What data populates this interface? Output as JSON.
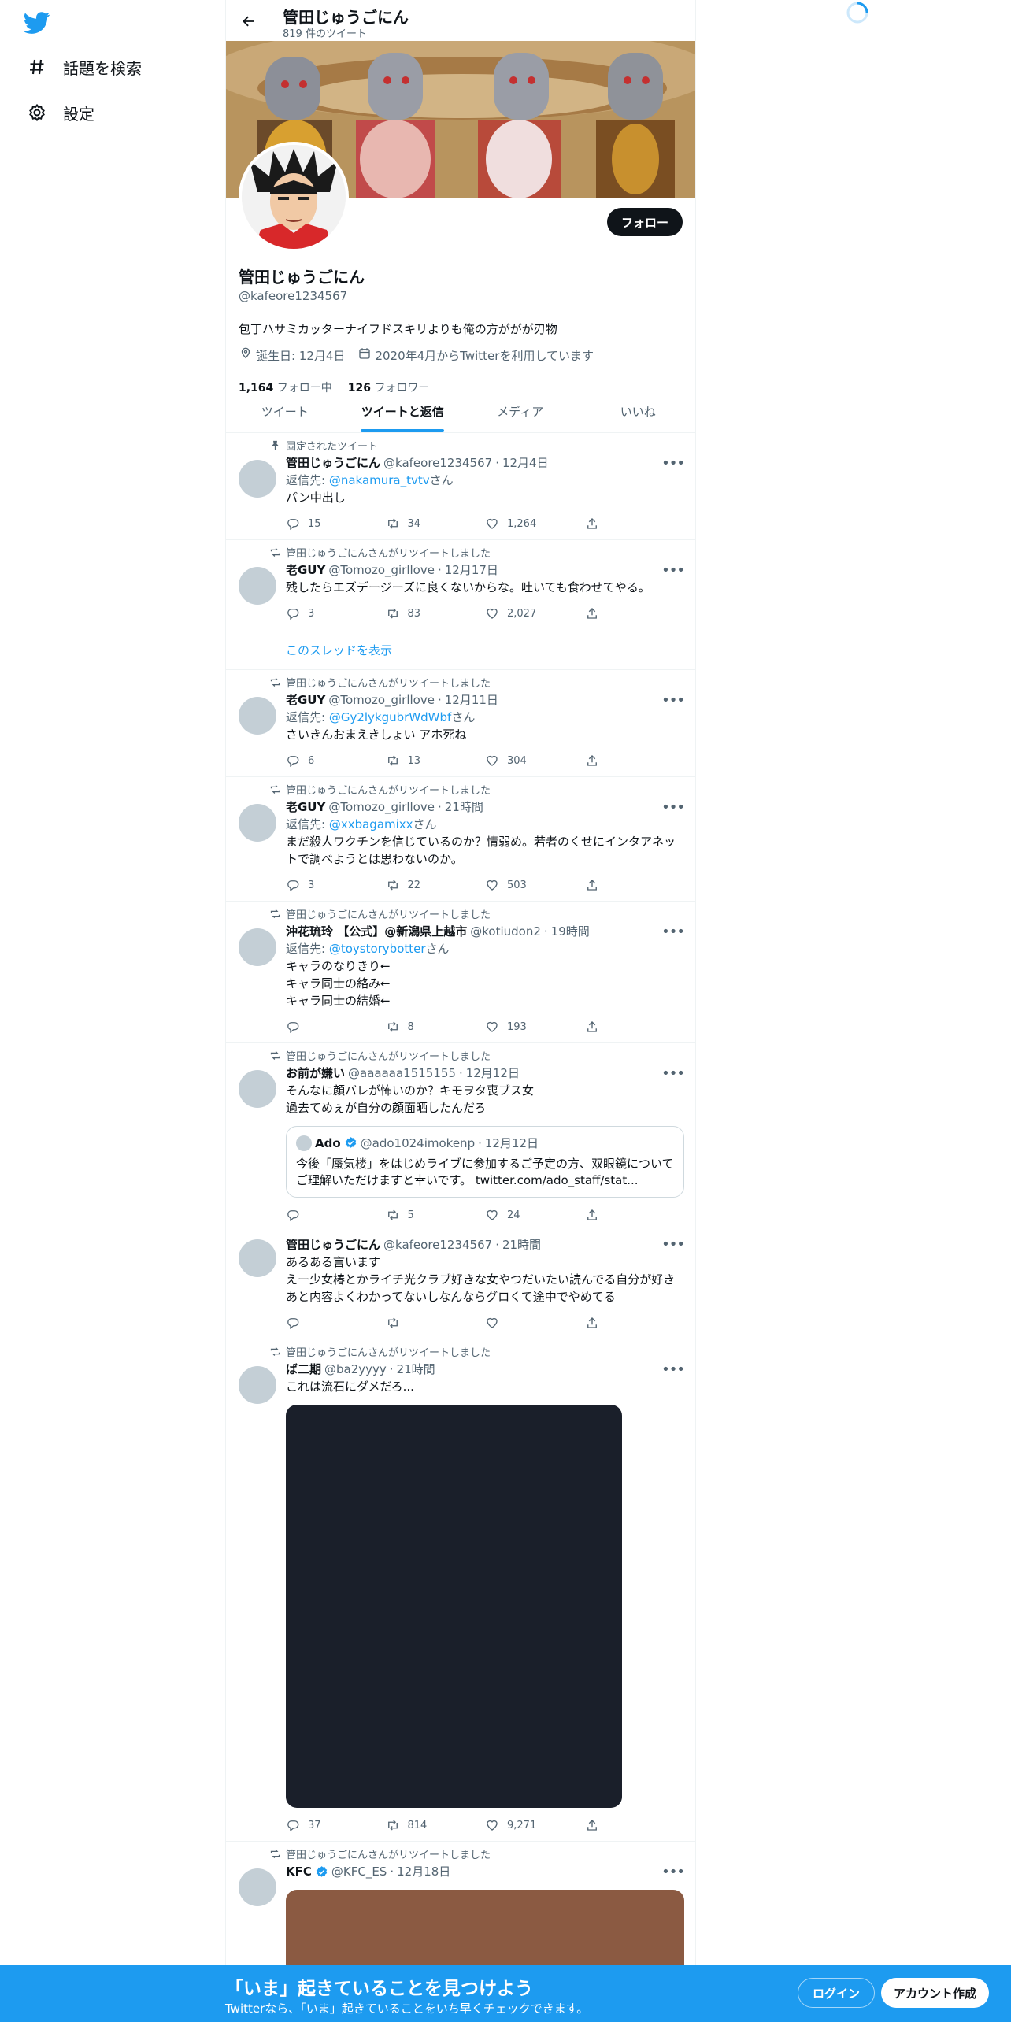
{
  "nav": {
    "logo": "twitter-bird-icon",
    "items": [
      {
        "label": "話題を検索",
        "icon": "hashtag-icon"
      },
      {
        "label": "設定",
        "icon": "gear-icon"
      }
    ]
  },
  "header": {
    "name": "管田じゅうごにん",
    "tweet_count": "819 件のツイート"
  },
  "profile": {
    "name": "管田じゅうごにん",
    "handle": "@kafeore1234567",
    "bio": "包丁ハサミカッターナイフドスキリよりも俺の方ががが刃物",
    "birthday": "誕生日: 12月4日",
    "joined": "2020年4月からTwitterを利用しています",
    "following_count": "1,164",
    "following_label": "フォロー中",
    "followers_count": "126",
    "followers_label": "フォロワー",
    "follow_button": "フォロー"
  },
  "tabs": [
    {
      "label": "ツイート",
      "active": false
    },
    {
      "label": "ツイートと返信",
      "active": true
    },
    {
      "label": "メディア",
      "active": false
    },
    {
      "label": "いいね",
      "active": false
    }
  ],
  "tweets": [
    {
      "social": "固定されたツイート",
      "social_icon": "pin-icon",
      "name": "管田じゅうごにん",
      "handle": "@kafeore1234567",
      "time": "12月4日",
      "reply_prefix": "返信先: ",
      "reply_to": "@nakamura_tvtv",
      "reply_suffix": "さん",
      "text": "パン中出し",
      "replies": "15",
      "retweets": "34",
      "likes": "1,264"
    },
    {
      "social": "管田じゅうごにんさんがリツイートしました",
      "social_icon": "retweet-icon",
      "name": "老GUY",
      "handle": "@Tomozo_girllove",
      "time": "12月17日",
      "text": "残したらエズデージーズに良くないからな。吐いても食わせてやる。",
      "replies": "3",
      "retweets": "83",
      "likes": "2,027",
      "thread": "このスレッドを表示"
    },
    {
      "social": "管田じゅうごにんさんがリツイートしました",
      "social_icon": "retweet-icon",
      "name": "老GUY",
      "handle": "@Tomozo_girllove",
      "time": "12月11日",
      "reply_prefix": "返信先: ",
      "reply_to": "@Gy2lykgubrWdWbf",
      "reply_suffix": "さん",
      "text": "さいきんおまえきしょい アホ死ね",
      "replies": "6",
      "retweets": "13",
      "likes": "304"
    },
    {
      "social": "管田じゅうごにんさんがリツイートしました",
      "social_icon": "retweet-icon",
      "name": "老GUY",
      "handle": "@Tomozo_girllove",
      "time": "21時間",
      "reply_prefix": "返信先: ",
      "reply_to": "@xxbagamixx",
      "reply_suffix": "さん",
      "text": "まだ殺人ワクチンを信じているのか？情弱め。若者のくせにインタアネットで調べようとは思わないのか。",
      "replies": "3",
      "retweets": "22",
      "likes": "503"
    },
    {
      "social": "管田じゅうごにんさんがリツイートしました",
      "social_icon": "retweet-icon",
      "name": "沖花琉玲 【公式】@新潟県上越市",
      "handle": "@kotiudon2",
      "time": "19時間",
      "reply_prefix": "返信先: ",
      "reply_to": "@toystorybotter",
      "reply_suffix": "さん",
      "text": "キャラのなりきり←\nキャラ同士の絡み←\nキャラ同士の結婚←",
      "replies": "",
      "retweets": "8",
      "likes": "193"
    },
    {
      "social": "管田じゅうごにんさんがリツイートしました",
      "social_icon": "retweet-icon",
      "name": "お前が嫌い",
      "handle": "@aaaaaa1515155",
      "time": "12月12日",
      "text": "そんなに顔バレが怖いのか？キモヲタ喪ブス女\n過去てめぇが自分の顔面晒したんだろ",
      "quote": {
        "name": "Ado",
        "handle": "@ado1024imokenp",
        "time": "12月12日",
        "text": "今後「蜃気楼」をはじめライブに参加するご予定の方、双眼鏡についてご理解いただけますと幸いです。 twitter.com/ado_staff/stat..."
      },
      "replies": "",
      "retweets": "5",
      "likes": "24"
    },
    {
      "social": "",
      "social_icon": "",
      "name": "管田じゅうごにん",
      "handle": "@kafeore1234567",
      "time": "21時間",
      "text": "あるある言います\nえー少女椿とかライチ光クラブ好きな女やつだいたい読んでる自分が好き\nあと内容よくわかってないしなんならグロくて途中でやめてる",
      "replies": "",
      "retweets": "",
      "likes": ""
    },
    {
      "social": "管田じゅうごにんさんがリツイートしました",
      "social_icon": "retweet-icon",
      "name": "ば二期",
      "handle": "@ba2yyyy",
      "time": "21時間",
      "text": "これは流石にダメだろ...",
      "media": "dark",
      "replies": "37",
      "retweets": "814",
      "likes": "9,271"
    },
    {
      "social": "管田じゅうごにんさんがリツイートしました",
      "social_icon": "retweet-icon",
      "name": "KFC",
      "verified": true,
      "handle": "@KFC_ES",
      "time": "12月18日",
      "text": "",
      "media": "brown"
    }
  ],
  "bottom_bar": {
    "title": "「いま」起きていることを見つけよう",
    "subtitle": "Twitterなら、「いま」起きていることをいち早くチェックできます。",
    "login": "ログイン",
    "signup": "アカウント作成"
  },
  "colors": {
    "accent": "#1d9bf0",
    "text": "#0f1419",
    "muted": "#536471"
  }
}
